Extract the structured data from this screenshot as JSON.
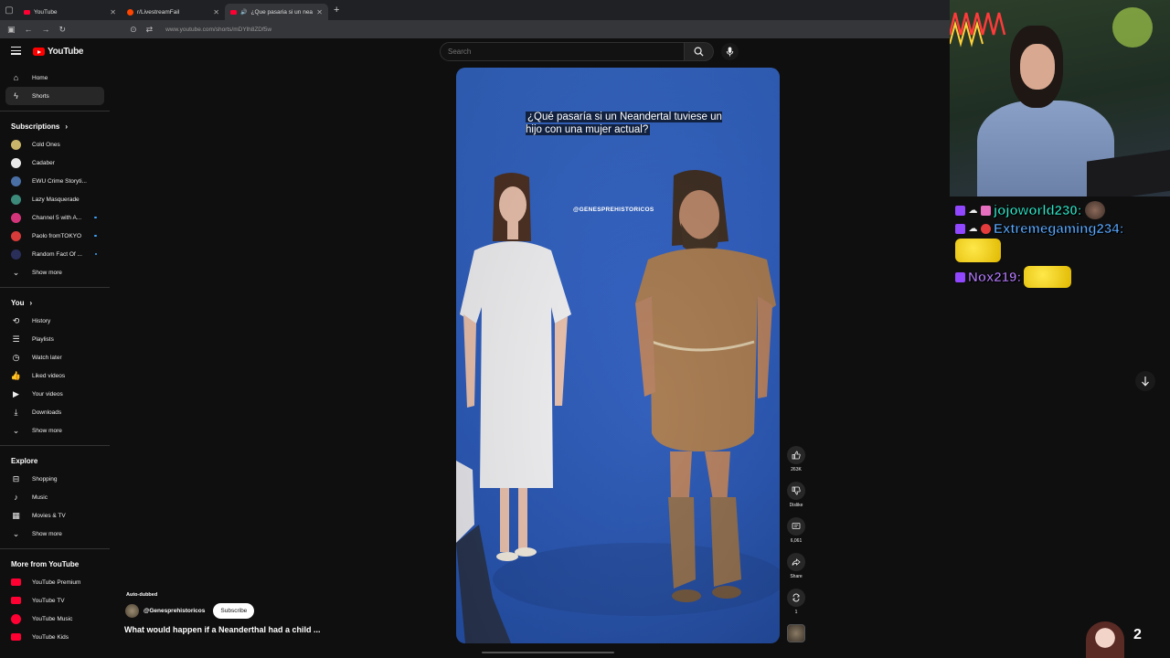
{
  "browser": {
    "tabs": [
      {
        "title": "YouTube",
        "active": false
      },
      {
        "title": "r/LivestreamFail",
        "active": false
      },
      {
        "title": "¿Que pasaria si un neander...",
        "active": true
      }
    ],
    "url": "www.youtube.com/shorts/mDYlh8ZDf5w"
  },
  "masthead": {
    "logo_text": "YouTube",
    "search_placeholder": "Search"
  },
  "sidebar": {
    "primary": [
      {
        "label": "Home",
        "icon": "home-icon"
      },
      {
        "label": "Shorts",
        "icon": "shorts-icon",
        "active": true
      }
    ],
    "subscriptions_title": "Subscriptions",
    "subscriptions": [
      {
        "label": "Cold Ones",
        "color": "#c9b56a",
        "new": false
      },
      {
        "label": "Cadaber",
        "color": "#e8e8e8",
        "new": false
      },
      {
        "label": "EWU Crime Storyti...",
        "color": "#4a6fa5",
        "new": false
      },
      {
        "label": "Lazy Masquerade",
        "color": "#3c8a7a",
        "new": false
      },
      {
        "label": "Channel 5 with A...",
        "color": "#d4357a",
        "new": true
      },
      {
        "label": "Paolo fromTOKYO",
        "color": "#d93a3a",
        "new": true
      },
      {
        "label": "Random Fact Of ...",
        "color": "#2a2f5a",
        "new": true
      }
    ],
    "show_more": "Show more",
    "you_title": "You",
    "you_items": [
      {
        "label": "History",
        "icon": "history-icon"
      },
      {
        "label": "Playlists",
        "icon": "playlists-icon"
      },
      {
        "label": "Watch later",
        "icon": "watch-later-icon"
      },
      {
        "label": "Liked videos",
        "icon": "liked-videos-icon"
      },
      {
        "label": "Your videos",
        "icon": "your-videos-icon"
      },
      {
        "label": "Downloads",
        "icon": "downloads-icon"
      }
    ],
    "explore_title": "Explore",
    "explore_items": [
      {
        "label": "Shopping",
        "icon": "shopping-icon"
      },
      {
        "label": "Music",
        "icon": "music-icon"
      },
      {
        "label": "Movies & TV",
        "icon": "movies-icon"
      }
    ],
    "more_title": "More from YouTube",
    "more_items": [
      {
        "label": "YouTube Premium",
        "shape": "rect"
      },
      {
        "label": "YouTube TV",
        "shape": "rect"
      },
      {
        "label": "YouTube Music",
        "shape": "round"
      },
      {
        "label": "YouTube Kids",
        "shape": "rect"
      }
    ]
  },
  "short": {
    "caption": "¿Qué pasaría si un Neandertal tuviese un hijo con una mujer actual?",
    "watermark": "@GENESPREHISTORICOS",
    "auto_dubbed": "Auto-dubbed",
    "channel": "@Genesprehistoricos",
    "subscribe_label": "Subscribe",
    "title": "What would happen if a Neanderthal had a child ..."
  },
  "actions": {
    "likes": "263K",
    "dislike_label": "Dislike",
    "comments": "6,061",
    "share_label": "Share",
    "remix_count": "1"
  },
  "stream_overlay": {
    "chat": [
      {
        "user": "jojoworld230:",
        "color": "#2ee6c8",
        "badges": [
          "twitch",
          "cloud",
          "sub"
        ]
      },
      {
        "user": "Extremegaming234:",
        "color": "#5aa9ff",
        "badges": [
          "twitch",
          "cloud",
          "red"
        ]
      },
      {
        "user": "Nox219:",
        "color": "#b67dff",
        "badges": [
          "twitch"
        ]
      }
    ],
    "viewer_count": "2"
  }
}
